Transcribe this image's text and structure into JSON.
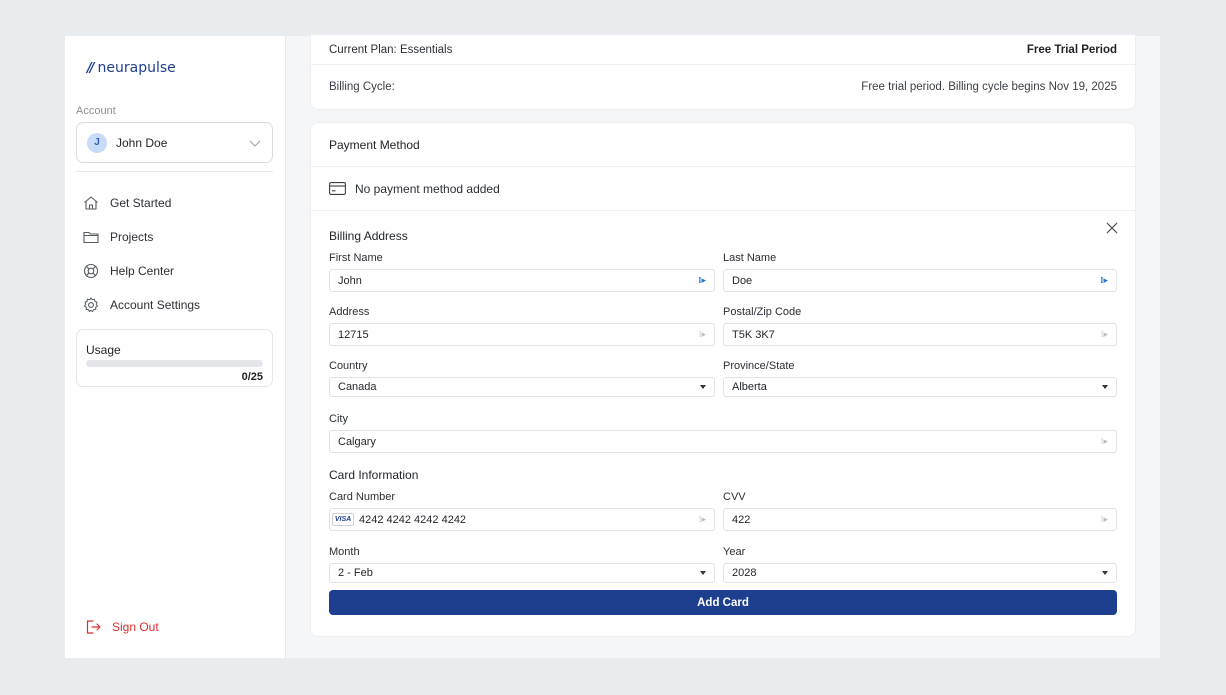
{
  "brand": {
    "name": "neurapulse",
    "mark": "//"
  },
  "sidebar": {
    "account_label": "Account",
    "account": {
      "initial": "J",
      "name": "John Doe"
    },
    "nav": [
      {
        "label": "Get Started",
        "icon": "home-icon"
      },
      {
        "label": "Projects",
        "icon": "folder-icon"
      },
      {
        "label": "Help Center",
        "icon": "lifebuoy-icon"
      },
      {
        "label": "Account Settings",
        "icon": "gear-icon"
      }
    ],
    "usage": {
      "title": "Usage",
      "count": "0/25",
      "fraction": 0
    },
    "sign_out": "Sign Out"
  },
  "plan": {
    "current_plan": "Current Plan: Essentials",
    "status": "Free Trial Period",
    "billing_cycle_label": "Billing Cycle:",
    "billing_cycle_value": "Free trial period. Billing cycle begins Nov 19, 2025"
  },
  "payment": {
    "title": "Payment Method",
    "none_text": "No payment method added",
    "billing_address_title": "Billing Address",
    "first_name": {
      "label": "First Name",
      "value": "John"
    },
    "last_name": {
      "label": "Last Name",
      "value": "Doe"
    },
    "address": {
      "label": "Address",
      "value": "12715"
    },
    "postal": {
      "label": "Postal/Zip Code",
      "value": "T5K 3K7"
    },
    "country": {
      "label": "Country",
      "value": "Canada"
    },
    "province": {
      "label": "Province/State",
      "value": "Alberta"
    },
    "city": {
      "label": "City",
      "value": "Calgary"
    },
    "card_info_title": "Card Information",
    "card_number": {
      "label": "Card Number",
      "value": "4242 4242 4242 4242",
      "brand": "VISA"
    },
    "cvv": {
      "label": "CVV",
      "value": "422"
    },
    "month": {
      "label": "Month",
      "value": "2 - Feb"
    },
    "year": {
      "label": "Year",
      "value": "2028"
    },
    "add_card": "Add Card"
  },
  "colors": {
    "primary": "#1e3f8f",
    "danger": "#d6302f",
    "background": "#e9ecef"
  }
}
